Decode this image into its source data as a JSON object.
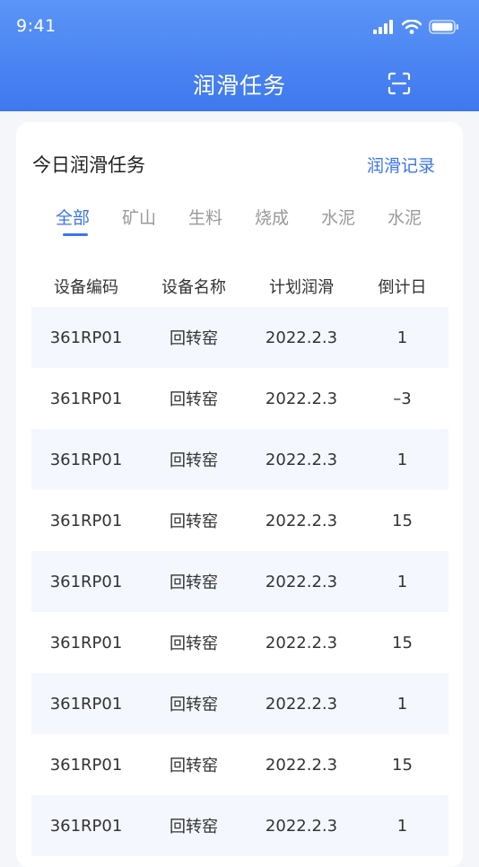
{
  "status_bar": {
    "time": "9:41"
  },
  "nav": {
    "title": "润滑任务"
  },
  "card": {
    "title": "今日润滑任务",
    "record_link": "润滑记录"
  },
  "tabs": [
    {
      "label": "全部",
      "active": true
    },
    {
      "label": "矿山",
      "active": false
    },
    {
      "label": "生料",
      "active": false
    },
    {
      "label": "烧成",
      "active": false
    },
    {
      "label": "水泥",
      "active": false
    },
    {
      "label": "水泥",
      "active": false
    }
  ],
  "table": {
    "headers": [
      "设备编码",
      "设备名称",
      "计划润滑",
      "倒计日"
    ],
    "rows": [
      [
        "361RP01",
        "回转窑",
        "2022.2.3",
        "1"
      ],
      [
        "361RP01",
        "回转窑",
        "2022.2.3",
        "–3"
      ],
      [
        "361RP01",
        "回转窑",
        "2022.2.3",
        "1"
      ],
      [
        "361RP01",
        "回转窑",
        "2022.2.3",
        "15"
      ],
      [
        "361RP01",
        "回转窑",
        "2022.2.3",
        "1"
      ],
      [
        "361RP01",
        "回转窑",
        "2022.2.3",
        "15"
      ],
      [
        "361RP01",
        "回转窑",
        "2022.2.3",
        "1"
      ],
      [
        "361RP01",
        "回转窑",
        "2022.2.3",
        "15"
      ],
      [
        "361RP01",
        "回转窑",
        "2022.2.3",
        "1"
      ]
    ]
  },
  "colors": {
    "primary": "#3b74ee",
    "header_top": "#5b95f7",
    "row_alt": "#f4f7fd"
  }
}
